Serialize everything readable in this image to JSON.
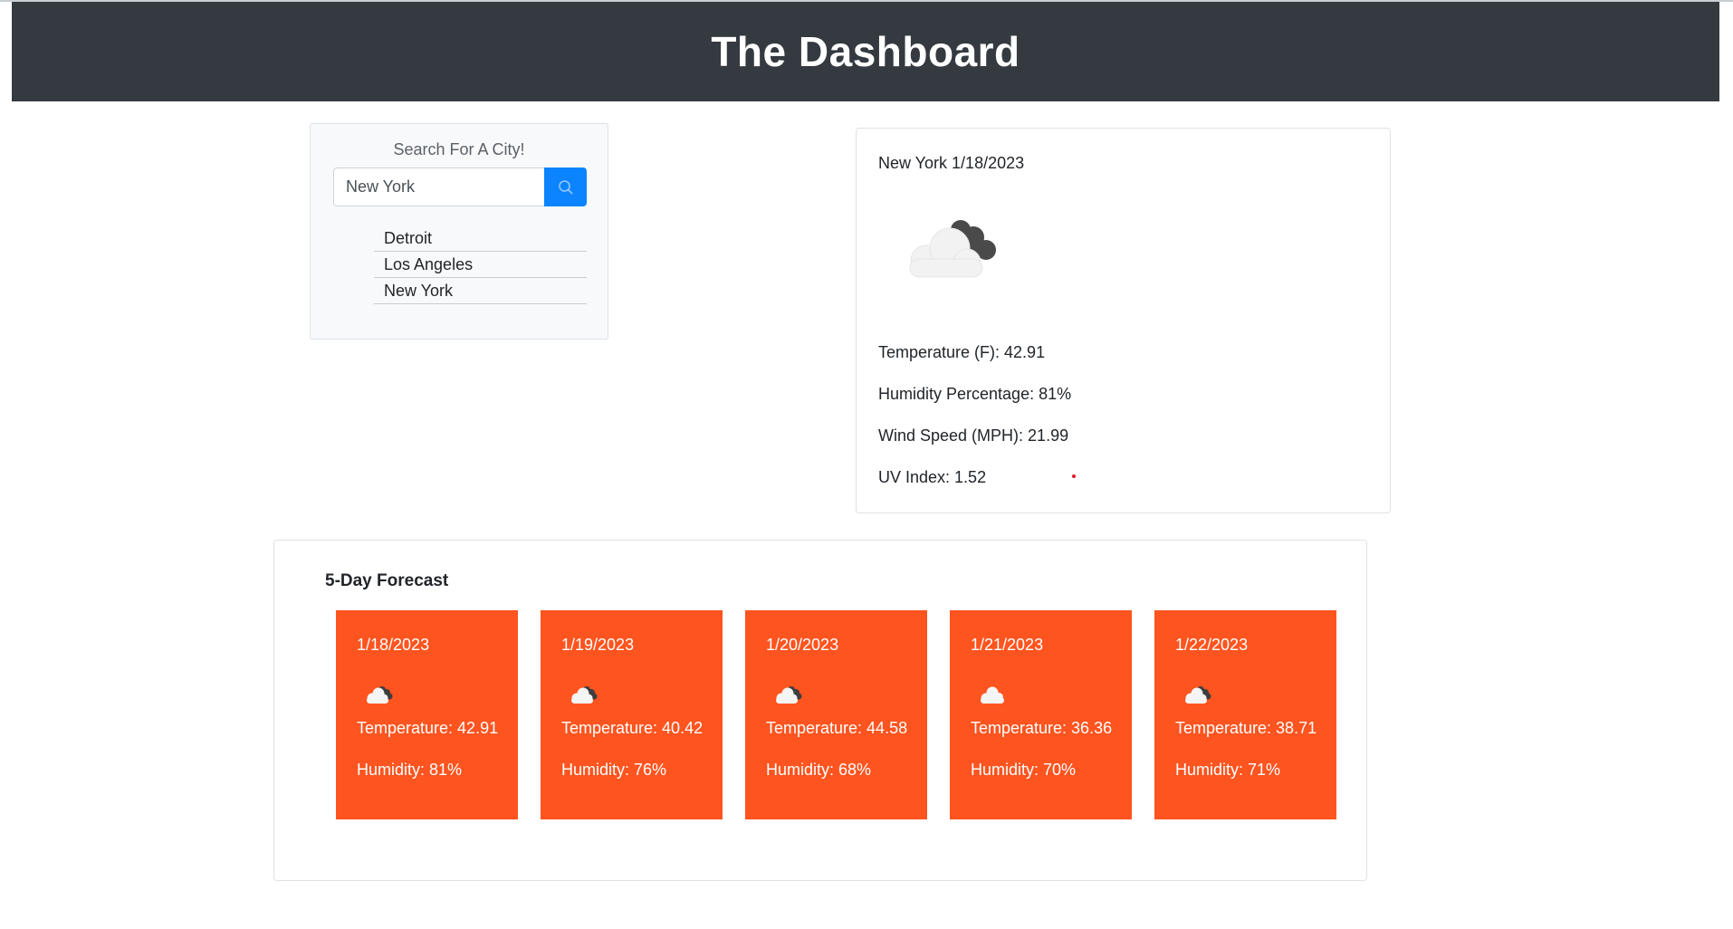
{
  "header": {
    "title": "The Dashboard"
  },
  "search": {
    "title": "Search For A City!",
    "value": "New York",
    "button_icon": "search-icon",
    "history": [
      "Detroit",
      "Los Angeles",
      "New York"
    ]
  },
  "current": {
    "city_date": "New York 1/18/2023",
    "icon": "cloud-icon",
    "temperature": "Temperature (F): 42.91",
    "humidity": "Humidity Percentage: 81%",
    "wind": "Wind Speed (MPH): 21.99",
    "uv": "UV Index: 1.52",
    "uv_color": "#e0162b"
  },
  "forecast": {
    "title": "5-Day Forecast",
    "card_color": "#fe541f",
    "days": [
      {
        "date": "1/18/2023",
        "temp": "Temperature: 42.91",
        "humidity": "Humidity: 81%",
        "icon": "cloudy-icon"
      },
      {
        "date": "1/19/2023",
        "temp": "Temperature: 40.42",
        "humidity": "Humidity: 76%",
        "icon": "cloudy-icon"
      },
      {
        "date": "1/20/2023",
        "temp": "Temperature: 44.58",
        "humidity": "Humidity: 68%",
        "icon": "cloudy-icon"
      },
      {
        "date": "1/21/2023",
        "temp": "Temperature: 36.36",
        "humidity": "Humidity: 70%",
        "icon": "cloud-icon"
      },
      {
        "date": "1/22/2023",
        "temp": "Temperature: 38.71",
        "humidity": "Humidity: 71%",
        "icon": "cloudy-icon"
      }
    ]
  },
  "colors": {
    "header_bg": "#343a40",
    "accent_blue": "#0d84ff"
  }
}
